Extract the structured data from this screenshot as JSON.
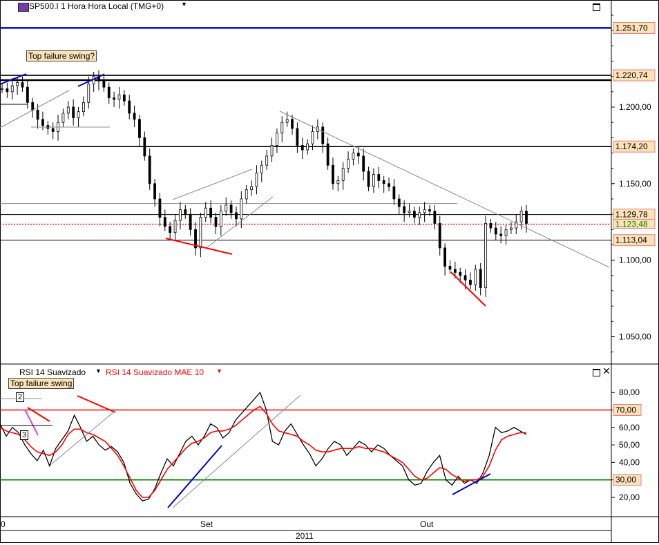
{
  "header": {
    "symbol_icon": "cfd-icon",
    "title": "SP500.I 1 Hora Hora Local (TMG+0)",
    "dropdown_icon": "caret-down-icon"
  },
  "rsi_header": {
    "rsi_label": "RSI 14 Suavizado",
    "mae_label": "RSI 14 Suavizado MAE 10"
  },
  "annotations": {
    "price_note": "Top failure swing?",
    "rsi_note": "Top failure swing",
    "point_2": "2",
    "point_3": "3"
  },
  "x_axis": {
    "left_partial": "0",
    "sep": "Set",
    "oct": "Out",
    "year": "2011"
  },
  "colors": {
    "price": "#000000",
    "rsi": "#000000",
    "mae": "#ff0000",
    "blue_level": "#0000cc",
    "red_trend": "#ff0000",
    "blue_trend": "#0000cc",
    "green_level": "#008000",
    "last_price_box": "#008000"
  },
  "chart_data": [
    {
      "type": "candlestick",
      "title": "SP500.I 1 Hora Hora Local (TMG+0)",
      "ylim": [
        1035,
        1270
      ],
      "y_ticks": [
        "1.050,00",
        "1.100,00",
        "1.150,00",
        "1.200,00"
      ],
      "y_tick_values": [
        1050,
        1100,
        1150,
        1200
      ],
      "levels": [
        {
          "value": 1251.7,
          "label": "1.251,70",
          "color": "#0000cc"
        },
        {
          "value": 1220.74,
          "label": "1.220,74",
          "color": "#000000"
        },
        {
          "value": 1174.2,
          "label": "1.174,20",
          "color": "#000000"
        },
        {
          "value": 1129.78,
          "label": "1.129,78",
          "color": "#000000"
        },
        {
          "value": 1113.04,
          "label": "1.113,04",
          "color": "#000000"
        }
      ],
      "last_price": {
        "value": 1123.48,
        "label": "1.123,48"
      },
      "close_series": [
        1212,
        1210,
        1214,
        1216,
        1213,
        1203,
        1198,
        1192,
        1188,
        1186,
        1184,
        1190,
        1196,
        1200,
        1193,
        1197,
        1203,
        1215,
        1220,
        1217,
        1213,
        1206,
        1205,
        1208,
        1204,
        1196,
        1192,
        1180,
        1168,
        1150,
        1140,
        1128,
        1122,
        1118,
        1126,
        1133,
        1130,
        1120,
        1108,
        1128,
        1134,
        1128,
        1122,
        1132,
        1136,
        1131,
        1127,
        1140,
        1146,
        1148,
        1157,
        1162,
        1168,
        1175,
        1183,
        1190,
        1192,
        1186,
        1175,
        1172,
        1176,
        1184,
        1187,
        1176,
        1162,
        1150,
        1152,
        1160,
        1166,
        1170,
        1168,
        1158,
        1148,
        1156,
        1152,
        1150,
        1148,
        1140,
        1135,
        1131,
        1132,
        1128,
        1131,
        1133,
        1132,
        1124,
        1108,
        1096,
        1094,
        1092,
        1090,
        1087,
        1084,
        1094,
        1082,
        1124,
        1121,
        1117,
        1116,
        1120,
        1121,
        1125,
        1132,
        1124
      ]
    },
    {
      "type": "line",
      "title": "RSI 14 Suavizado",
      "ylim": [
        10,
        82
      ],
      "y_ticks": [
        "20,00",
        "30,00",
        "40,00",
        "50,00",
        "60,00",
        "70,00",
        "80,00"
      ],
      "y_tick_values": [
        20,
        30,
        40,
        50,
        60,
        70,
        80
      ],
      "levels": [
        {
          "value": 70,
          "label": "70,00",
          "color": "#ff0000"
        },
        {
          "value": 30,
          "label": "30,00",
          "color": "#008000"
        }
      ],
      "series": [
        {
          "name": "RSI 14 Suavizado",
          "values": [
            62,
            55,
            60,
            57,
            50,
            45,
            41,
            47,
            38,
            48,
            53,
            58,
            67,
            60,
            52,
            55,
            50,
            47,
            49,
            46,
            40,
            28,
            22,
            18,
            19,
            25,
            34,
            42,
            38,
            45,
            52,
            55,
            50,
            55,
            62,
            60,
            54,
            57,
            64,
            68,
            72,
            76,
            80,
            70,
            52,
            50,
            58,
            62,
            56,
            50,
            45,
            38,
            42,
            48,
            52,
            50,
            44,
            48,
            52,
            50,
            46,
            50,
            48,
            44,
            41,
            38,
            30,
            27,
            28,
            35,
            40,
            44,
            30,
            27,
            32,
            28,
            30,
            28,
            34,
            44,
            60,
            57,
            58,
            60,
            58,
            56
          ]
        },
        {
          "name": "RSI 14 Suavizado MAE 10",
          "values": [
            60,
            58,
            57,
            56,
            53,
            49,
            46,
            45,
            44,
            46,
            50,
            56,
            59,
            59,
            57,
            56,
            54,
            52,
            48,
            44,
            38,
            31,
            24,
            20,
            20,
            24,
            30,
            36,
            40,
            44,
            48,
            51,
            52,
            54,
            57,
            58,
            58,
            59,
            61,
            64,
            67,
            70,
            72,
            68,
            62,
            58,
            57,
            56,
            55,
            52,
            50,
            47,
            46,
            46,
            47,
            48,
            48,
            48,
            49,
            48,
            48,
            47,
            46,
            44,
            42,
            40,
            36,
            32,
            30,
            31,
            34,
            37,
            36,
            33,
            31,
            29,
            30,
            30,
            32,
            38,
            47,
            53,
            55,
            56,
            57,
            57
          ]
        }
      ]
    }
  ]
}
